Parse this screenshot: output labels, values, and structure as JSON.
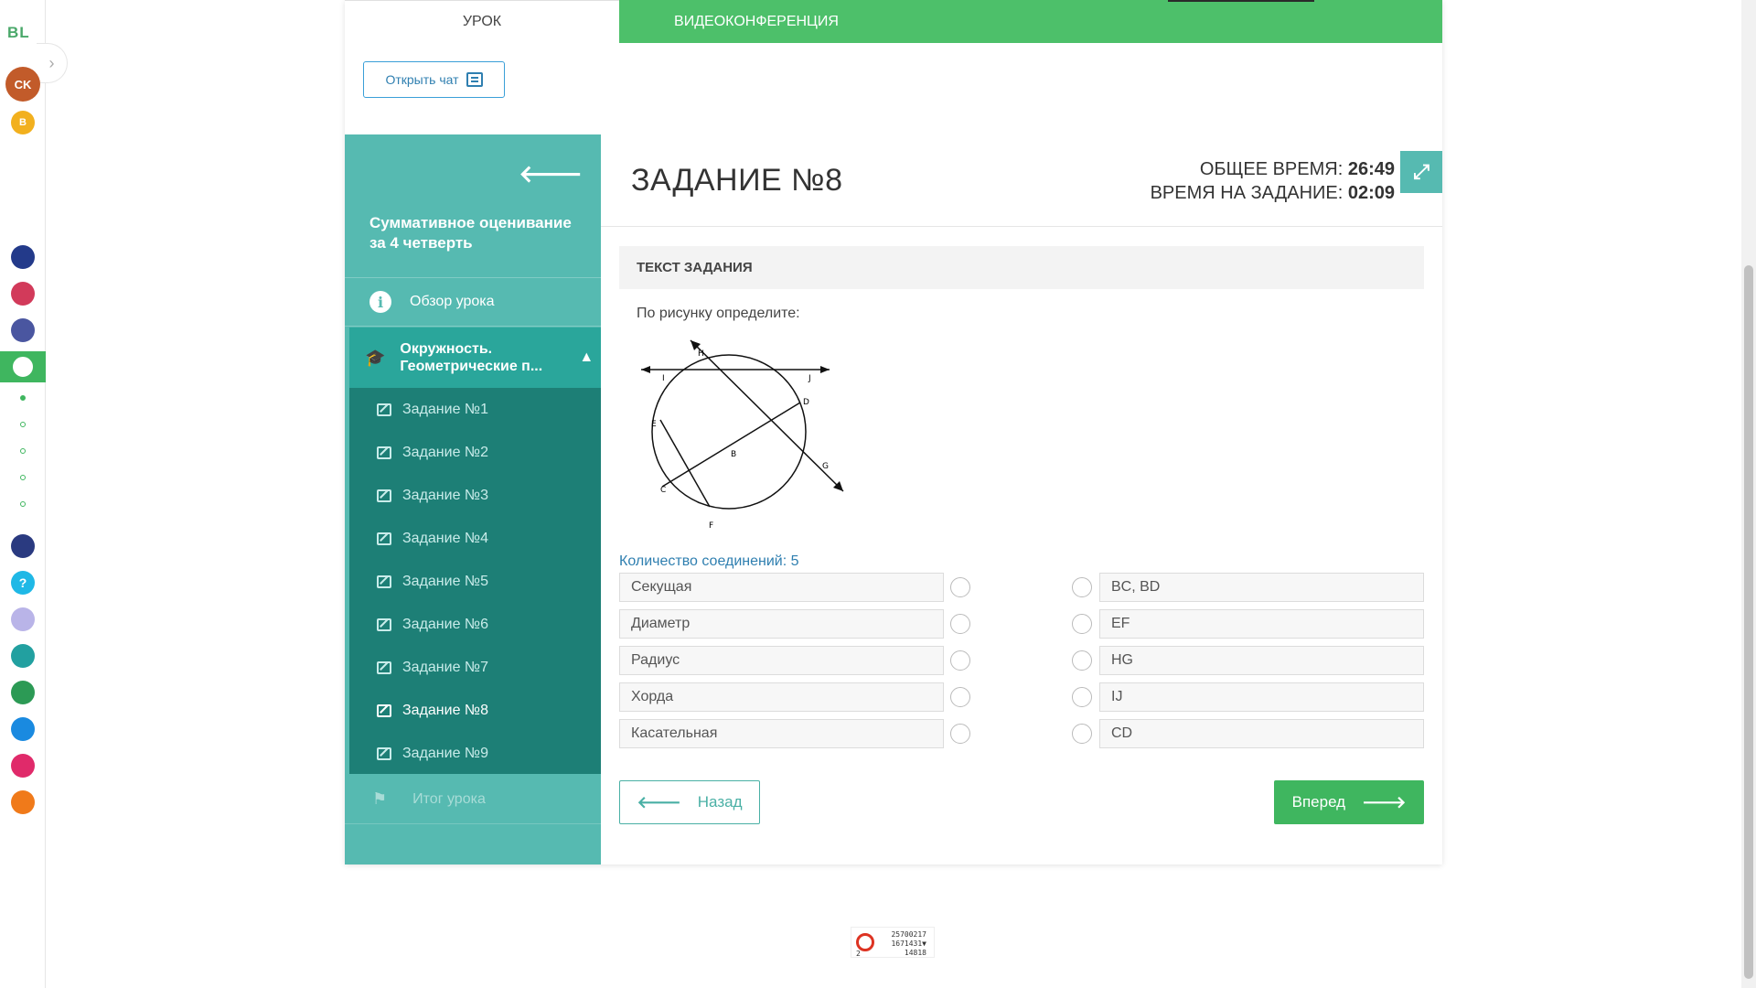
{
  "rail": {
    "logo": "BL",
    "avatar_initials": "CK",
    "badge_initial": "B",
    "colors": {
      "active": "#3fb65f",
      "avatar": "#c25b2a",
      "badge": "#f2b01e"
    }
  },
  "tabs": [
    {
      "label": "УРОК"
    },
    {
      "label": "ВИДЕОКОНФЕРЕНЦИЯ"
    }
  ],
  "chat_button": {
    "label": "Открыть чат",
    "icon": "chat-icon"
  },
  "sidebar": {
    "back_icon": "arrow-left-icon",
    "course_title": "Суммативное оценивание за 4 четверть",
    "overview_label": "Обзор урока",
    "topic_label": "Окружность. Геометрические п...",
    "tasks": [
      {
        "label": "Задание №1"
      },
      {
        "label": "Задание №2"
      },
      {
        "label": "Задание №3"
      },
      {
        "label": "Задание №4"
      },
      {
        "label": "Задание №5"
      },
      {
        "label": "Задание №6"
      },
      {
        "label": "Задание №7"
      },
      {
        "label": "Задание №8"
      },
      {
        "label": "Задание №9"
      }
    ],
    "current_task_index": 7,
    "result_label": "Итог урока"
  },
  "main": {
    "title": "ЗАДАНИЕ №8",
    "total_time_label": "ОБЩЕЕ ВРЕМЯ:",
    "total_time_value": "26:49",
    "task_time_label": "ВРЕМЯ НА ЗАДАНИЕ:",
    "task_time_value": "02:09",
    "section_header": "ТЕКСТ ЗАДАНИЯ",
    "prompt": "По рисунку определите:",
    "figure_labels": {
      "H": "H",
      "I": "I",
      "J": "J",
      "D": "D",
      "E": "E",
      "B": "B",
      "G": "G",
      "C": "C",
      "F": "F"
    },
    "connections_label": "Количество соединений: 5",
    "left_items": [
      "Секущая",
      "Диаметр",
      "Радиус",
      "Хорда",
      "Касательная"
    ],
    "right_items": [
      "BC, BD",
      "EF",
      "HG",
      "IJ",
      "CD"
    ],
    "prev_label": "Назад",
    "next_label": "Вперед"
  },
  "counter": {
    "line1": "25700217",
    "line2": "1671431▼",
    "line3": "14818",
    "small": "2"
  }
}
